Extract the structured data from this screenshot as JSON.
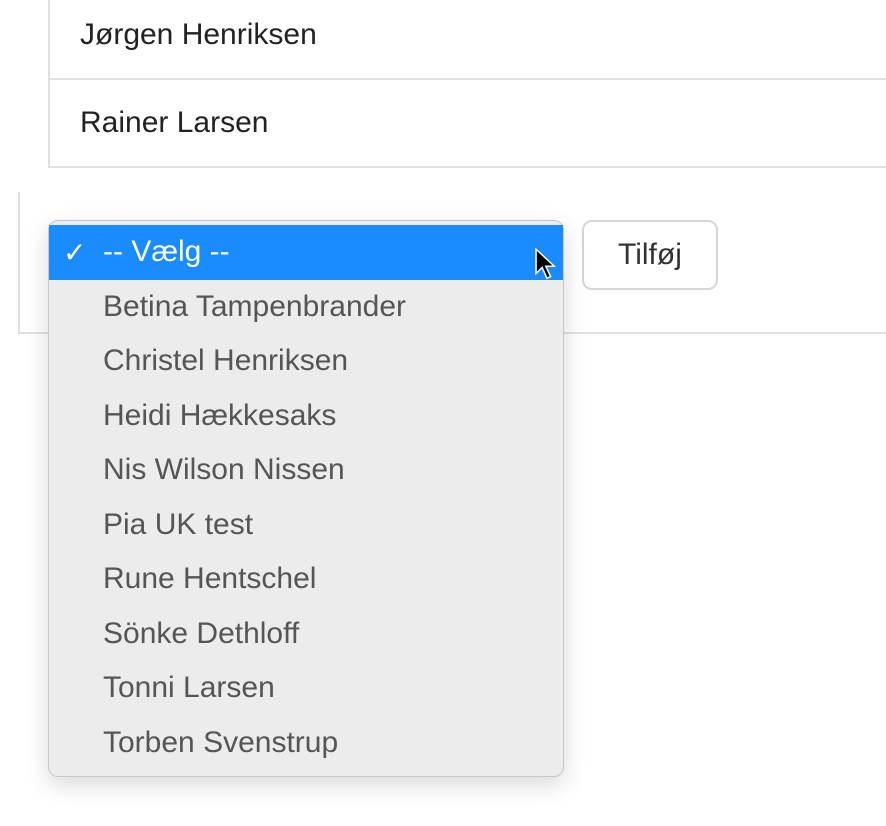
{
  "list": {
    "rows": [
      {
        "name": "Jørgen Henriksen"
      },
      {
        "name": "Rainer Larsen"
      }
    ]
  },
  "dropdown": {
    "selected_index": 0,
    "options": [
      {
        "label": "-- Vælg --",
        "selected": true
      },
      {
        "label": "Betina Tampenbrander",
        "selected": false
      },
      {
        "label": "Christel Henriksen",
        "selected": false
      },
      {
        "label": "Heidi Hækkesaks",
        "selected": false
      },
      {
        "label": "Nis Wilson Nissen",
        "selected": false
      },
      {
        "label": "Pia UK test",
        "selected": false
      },
      {
        "label": "Rune Hentschel",
        "selected": false
      },
      {
        "label": "Sönke Dethloff",
        "selected": false
      },
      {
        "label": "Tonni Larsen",
        "selected": false
      },
      {
        "label": "Torben Svenstrup",
        "selected": false
      }
    ]
  },
  "buttons": {
    "add_label": "Tilføj"
  },
  "icons": {
    "checkmark": "✓"
  }
}
